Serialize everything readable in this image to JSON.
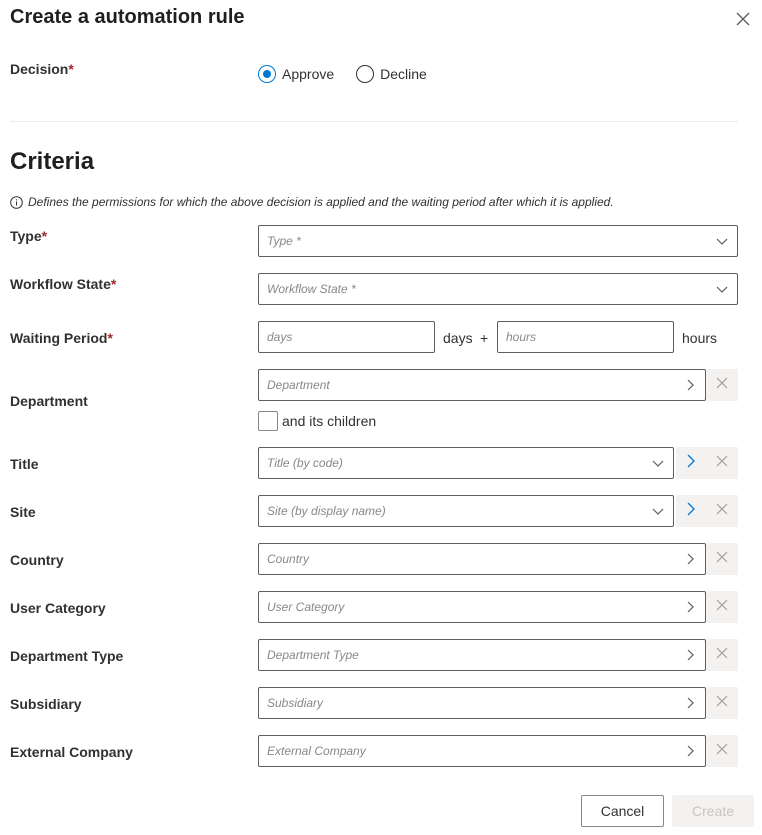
{
  "dialog": {
    "title": "Create a automation rule"
  },
  "decision": {
    "label": "Decision",
    "required_mark": "*",
    "options": [
      {
        "label": "Approve",
        "checked": true
      },
      {
        "label": "Decline",
        "checked": false
      }
    ]
  },
  "criteria": {
    "title": "Criteria",
    "info_text": "Defines the permissions for which the above decision is applied and the waiting period after which it is applied."
  },
  "fields": {
    "type": {
      "label": "Type",
      "required_mark": "*",
      "placeholder": "Type *"
    },
    "workflow_state": {
      "label": "Workflow State",
      "required_mark": "*",
      "placeholder": "Workflow State *"
    },
    "waiting_period": {
      "label": "Waiting Period",
      "required_mark": "*",
      "days_placeholder": "days",
      "days_unit": "days",
      "plus": "+",
      "hours_placeholder": "hours",
      "hours_unit": "hours"
    },
    "department": {
      "label": "Department",
      "placeholder": "Department",
      "children_label": "and its children"
    },
    "title": {
      "label": "Title",
      "placeholder": "Title (by code)"
    },
    "site": {
      "label": "Site",
      "placeholder": "Site (by display name)"
    },
    "country": {
      "label": "Country",
      "placeholder": "Country"
    },
    "user_category": {
      "label": "User Category",
      "placeholder": "User Category"
    },
    "department_type": {
      "label": "Department Type",
      "placeholder": "Department Type"
    },
    "subsidiary": {
      "label": "Subsidiary",
      "placeholder": "Subsidiary"
    },
    "external_company": {
      "label": "External Company",
      "placeholder": "External Company"
    }
  },
  "footer": {
    "cancel_label": "Cancel",
    "create_label": "Create"
  },
  "colors": {
    "accent": "#0078d4",
    "required": "#a4262c",
    "border": "#605e5c",
    "disabled_bg": "#f3f2f1"
  },
  "icons": [
    "close-icon",
    "info-icon",
    "chevron-down-icon",
    "chevron-right-icon",
    "clear-icon"
  ]
}
